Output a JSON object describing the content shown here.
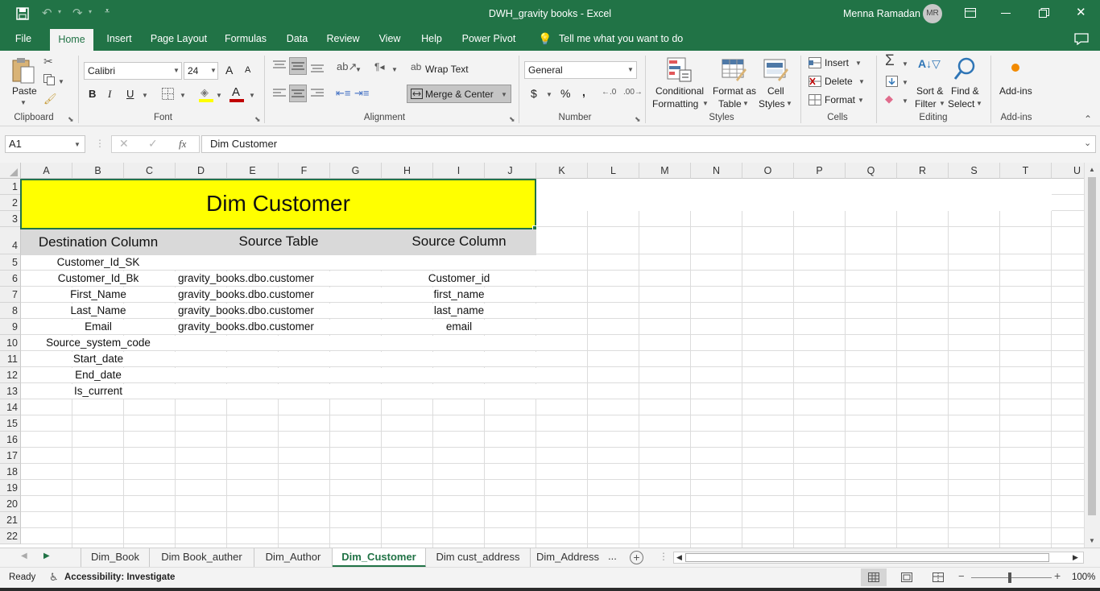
{
  "app": {
    "document_title": "DWH_gravity books",
    "separator": "-",
    "app_name": "Excel",
    "user_name": "Menna Ramadan",
    "user_initials": "MR"
  },
  "ribbon_tabs": [
    {
      "label": "File"
    },
    {
      "label": "Home"
    },
    {
      "label": "Insert"
    },
    {
      "label": "Page Layout"
    },
    {
      "label": "Formulas"
    },
    {
      "label": "Data"
    },
    {
      "label": "Review"
    },
    {
      "label": "View"
    },
    {
      "label": "Help"
    },
    {
      "label": "Power Pivot"
    }
  ],
  "tell_me": "Tell me what you want to do",
  "ribbon": {
    "clipboard": {
      "paste": "Paste",
      "group": "Clipboard"
    },
    "font": {
      "name": "Calibri",
      "size": "24",
      "bold": "B",
      "italic": "I",
      "underline": "U",
      "grow": "A",
      "shrink": "A",
      "font_color_letter": "A",
      "fill_color": "#FFFF00",
      "font_color": "#C00000",
      "group": "Font"
    },
    "alignment": {
      "wrap_text": "Wrap Text",
      "merge_center": "Merge & Center",
      "group": "Alignment"
    },
    "number": {
      "format": "General",
      "currency": "$",
      "percent": "%",
      "comma": ",",
      "group": "Number"
    },
    "styles": {
      "conditional_1": "Conditional",
      "conditional_2": "Formatting",
      "format_as_1": "Format as",
      "format_as_2": "Table",
      "cell_styles_1": "Cell",
      "cell_styles_2": "Styles",
      "group": "Styles"
    },
    "cells": {
      "insert": "Insert",
      "delete": "Delete",
      "format": "Format",
      "group": "Cells"
    },
    "editing": {
      "sort_1": "Sort &",
      "sort_2": "Filter",
      "find_1": "Find &",
      "find_2": "Select",
      "group": "Editing"
    },
    "addins": {
      "label": "Add-ins",
      "group": "Add-ins"
    }
  },
  "formula_bar": {
    "name_box": "A1",
    "fx": "fx",
    "value": "Dim Customer"
  },
  "columns": [
    "A",
    "B",
    "C",
    "D",
    "E",
    "F",
    "G",
    "H",
    "I",
    "J",
    "K",
    "L",
    "M",
    "N",
    "O",
    "P",
    "Q",
    "R",
    "S",
    "T",
    "U"
  ],
  "rows": [
    "1",
    "2",
    "3",
    "4",
    "5",
    "6",
    "7",
    "8",
    "9",
    "10",
    "11",
    "12",
    "13",
    "14",
    "15",
    "16",
    "17",
    "18",
    "19",
    "20",
    "21",
    "22"
  ],
  "sheet": {
    "title": "Dim Customer",
    "title_fill": "#FFFF00",
    "header_fill": "#D9D9D9",
    "headers": {
      "destination": "Destination Column",
      "source_table": "Source Table",
      "source_column": "Source  Column"
    },
    "mapping": [
      {
        "dest": "Customer_Id_SK",
        "table": "",
        "column": ""
      },
      {
        "dest": "Customer_Id_Bk",
        "table": "gravity_books.dbo.customer",
        "column": "Customer_id"
      },
      {
        "dest": "First_Name",
        "table": "gravity_books.dbo.customer",
        "column": "first_name"
      },
      {
        "dest": "Last_Name",
        "table": "gravity_books.dbo.customer",
        "column": "last_name"
      },
      {
        "dest": "Email",
        "table": "gravity_books.dbo.customer",
        "column": "email"
      },
      {
        "dest": "Source_system_code",
        "table": "",
        "column": ""
      },
      {
        "dest": "Start_date",
        "table": "",
        "column": ""
      },
      {
        "dest": "End_date",
        "table": "",
        "column": ""
      },
      {
        "dest": "Is_current",
        "table": "",
        "column": ""
      }
    ]
  },
  "sheet_tabs": [
    {
      "label": "Dim_Book"
    },
    {
      "label": "Dim Book_auther"
    },
    {
      "label": "Dim_Author"
    },
    {
      "label": "Dim_Customer"
    },
    {
      "label": "Dim cust_address"
    },
    {
      "label": "Dim_Address"
    }
  ],
  "more_tabs": "...",
  "status": {
    "mode": "Ready",
    "accessibility": "Accessibility: Investigate",
    "zoom": "100%"
  },
  "accent": "#217346"
}
